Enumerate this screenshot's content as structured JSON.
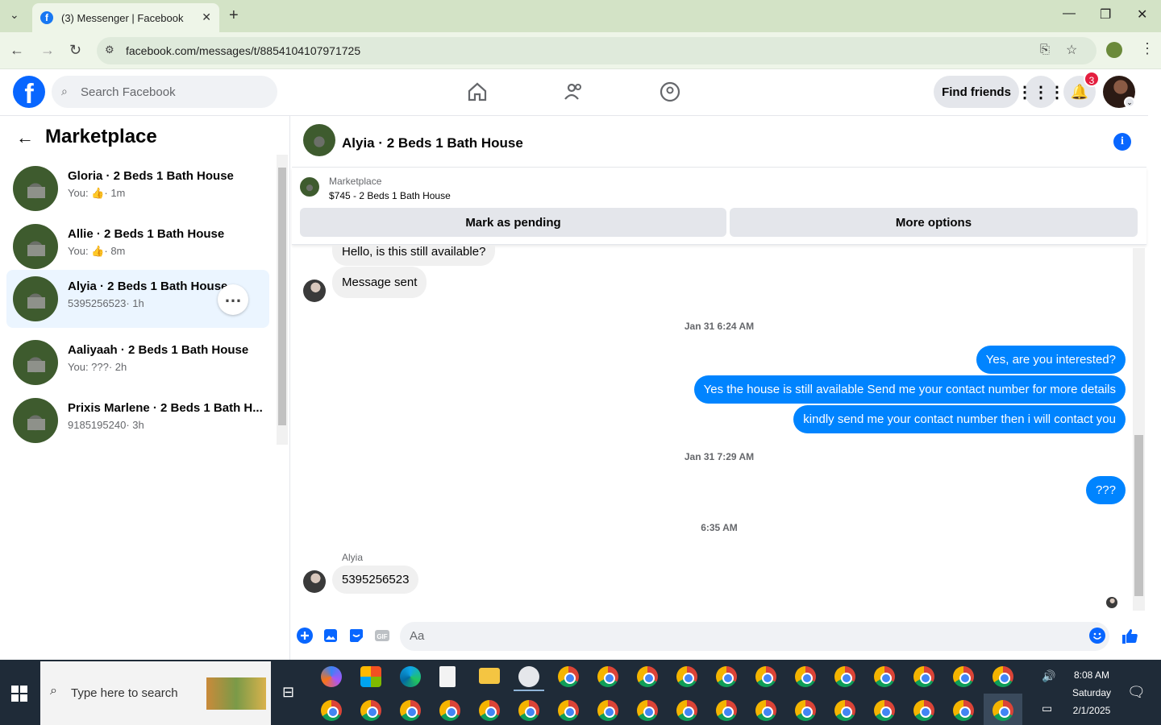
{
  "browser": {
    "tab_title": "(3) Messenger | Facebook",
    "url": "facebook.com/messages/t/8854104107971725"
  },
  "header": {
    "search_placeholder": "Search Facebook",
    "find_friends": "Find friends",
    "notification_count": "3"
  },
  "sidebar": {
    "title": "Marketplace",
    "conversations": [
      {
        "title": "Gloria · 2 Beds 1 Bath House",
        "prefix": "You:",
        "icon": "thumbs-up-icon",
        "time": "· 1m",
        "active": false
      },
      {
        "title": "Allie · 2 Beds 1 Bath House",
        "prefix": "You:",
        "icon": "thumbs-up-icon",
        "time": "· 8m",
        "active": false
      },
      {
        "title": "Alyia · 2 Beds 1 Bath House",
        "prefix": "5395256523",
        "time": "· 1h",
        "active": true
      },
      {
        "title": "Aaliyaah · 2 Beds 1 Bath House",
        "prefix": "You: ???",
        "time": "· 2h",
        "active": false
      },
      {
        "title": "Prixis Marlene · 2 Beds 1 Bath H...",
        "prefix": "9185195240",
        "time": "· 3h",
        "active": false
      }
    ]
  },
  "chat": {
    "name": "Alyia · 2 Beds 1 Bath House",
    "listing_label": "Marketplace",
    "listing_price": "$745 - 2 Beds 1 Bath House",
    "mark_pending": "Mark as pending",
    "more_options": "More options",
    "messages": {
      "m1": "Hello, is this still available?",
      "m2": "Message sent",
      "ts1": "Jan 31 6:24 AM",
      "m3": "Yes, are you interested?",
      "m4": "Yes the house is still available Send me your contact number for more details",
      "m5": "kindly send me your contact number then i will contact you",
      "ts2": "Jan 31 7:29 AM",
      "m6": "???",
      "ts3": "6:35 AM",
      "sender": "Alyia",
      "m7": "5395256523"
    },
    "input_placeholder": "Aa"
  },
  "taskbar": {
    "search_placeholder": "Type here to search",
    "time": "8:08 AM",
    "day": "Saturday",
    "date": "2/1/2025"
  },
  "colors": {
    "accent": "#0866ff",
    "bubble_out": "#0084ff",
    "active_row": "#ebf5ff"
  }
}
